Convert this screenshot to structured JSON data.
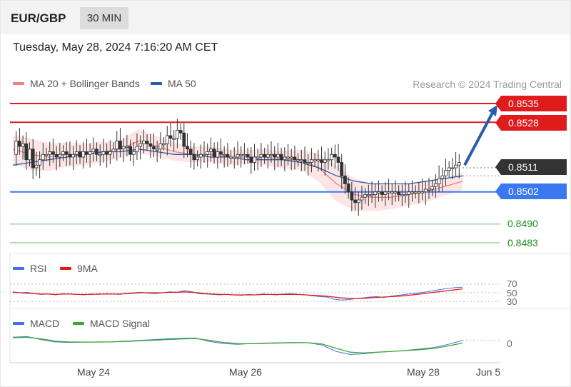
{
  "header": {
    "pair": "EUR/GBP",
    "timeframe": "30 MIN"
  },
  "timestamp": "Tuesday, May 28, 2024 7:16:20 AM CET",
  "credit": "Research © 2024 Trading Central",
  "colors": {
    "resistance": "#e01b1b",
    "support": "#3a78f2",
    "current": "#333333",
    "pivot_green": "#1e8f1e",
    "ma20": "#f08080",
    "ma50": "#2a5fa8",
    "bollinger_fill": "#fde0e0",
    "arrow": "#2a5fa8",
    "rsi": "#4a6fe3",
    "rsi_ma": "#e01b1b",
    "macd": "#4a6fe3",
    "macd_signal": "#3aa832"
  },
  "chart_data": [
    {
      "type": "candlestick",
      "title": "EUR/GBP 30 MIN",
      "legend": [
        "MA 20 + Bollinger Bands",
        "MA 50"
      ],
      "ylim": [
        0.848,
        0.854
      ],
      "levels": [
        {
          "label": "0.8535",
          "value": 0.8535,
          "kind": "resistance"
        },
        {
          "label": "0.8528",
          "value": 0.8528,
          "kind": "resistance"
        },
        {
          "label": "0.8511",
          "value": 0.8511,
          "kind": "current"
        },
        {
          "label": "0.8502",
          "value": 0.8502,
          "kind": "support"
        },
        {
          "label": "0.8490",
          "value": 0.849,
          "kind": "pivot"
        },
        {
          "label": "0.8483",
          "value": 0.8483,
          "kind": "pivot"
        }
      ],
      "price_path": [
        0.8516,
        0.8521,
        0.8519,
        0.852,
        0.8514,
        0.8518,
        0.8511,
        0.8512,
        0.8514,
        0.8516,
        0.8516,
        0.8517,
        0.8516,
        0.8515,
        0.8516,
        0.8517,
        0.8516,
        0.8515,
        0.8516,
        0.8517,
        0.8515,
        0.8517,
        0.8516,
        0.8517,
        0.8518,
        0.8516,
        0.8516,
        0.8517,
        0.8516,
        0.8517,
        0.8518,
        0.8521,
        0.8518,
        0.8519,
        0.8519,
        0.8516,
        0.8517,
        0.8519,
        0.852,
        0.8521,
        0.852,
        0.8519,
        0.8518,
        0.8518,
        0.852,
        0.852,
        0.8523,
        0.8522,
        0.8522,
        0.8525,
        0.8524,
        0.8519,
        0.8518,
        0.8516,
        0.8514,
        0.8515,
        0.8516,
        0.8516,
        0.8517,
        0.8518,
        0.8515,
        0.8517,
        0.8516,
        0.8516,
        0.8515,
        0.8515,
        0.8515,
        0.8516,
        0.8516,
        0.8516,
        0.8515,
        0.8513,
        0.8515,
        0.8515,
        0.8516,
        0.8515,
        0.8516,
        0.8516,
        0.8515,
        0.8516,
        0.8514,
        0.8515,
        0.8515,
        0.8515,
        0.8514,
        0.8514,
        0.8514,
        0.8513,
        0.8513,
        0.8514,
        0.8514,
        0.8514,
        0.8513,
        0.8514,
        0.8514,
        0.8516,
        0.8515,
        0.8513,
        0.8508,
        0.8505,
        0.8502,
        0.8499,
        0.8498,
        0.8499,
        0.85,
        0.8501,
        0.8501,
        0.8501,
        0.8502,
        0.8502,
        0.8501,
        0.8502,
        0.8502,
        0.8502,
        0.8502,
        0.8501,
        0.8501,
        0.8501,
        0.8502,
        0.8502,
        0.8502,
        0.8502,
        0.8502,
        0.8503,
        0.8503,
        0.8504,
        0.8505,
        0.8507,
        0.8508,
        0.851,
        0.8511,
        0.8511,
        0.8512,
        0.8513
      ],
      "ma50_path": [
        0.8512,
        0.8513,
        0.8514,
        0.8515,
        0.8516,
        0.8517,
        0.8517,
        0.8518,
        0.8517,
        0.8516,
        0.8516,
        0.8515,
        0.8515,
        0.8514,
        0.8514,
        0.8514,
        0.8513,
        0.8511,
        0.8508,
        0.8506,
        0.8505,
        0.8505,
        0.8505,
        0.8506,
        0.8507,
        0.8508
      ],
      "ma20_path": [
        0.8518,
        0.8516,
        0.8515,
        0.8516,
        0.8516,
        0.8517,
        0.8518,
        0.8521,
        0.8519,
        0.8517,
        0.8516,
        0.8516,
        0.8515,
        0.8515,
        0.8515,
        0.8514,
        0.8514,
        0.8511,
        0.8505,
        0.8501,
        0.85,
        0.85,
        0.8501,
        0.8502,
        0.8504,
        0.8506
      ],
      "forecast": {
        "from": 0.8512,
        "to": 0.8535
      }
    },
    {
      "type": "line",
      "legend": [
        "RSI",
        "9MA"
      ],
      "ylim": [
        20,
        80
      ],
      "tick_labels": [
        "70",
        "50",
        "30"
      ],
      "ticks": [
        70,
        50,
        30
      ],
      "rsi": [
        52,
        50,
        51,
        48,
        46,
        47,
        45,
        48,
        47,
        46,
        45,
        47,
        46,
        48,
        47,
        46,
        49,
        50,
        51,
        49,
        48,
        50,
        52,
        51,
        55,
        53,
        48,
        47,
        46,
        45,
        46,
        45,
        44,
        46,
        45,
        47,
        46,
        45,
        47,
        48,
        46,
        45,
        43,
        41,
        40,
        35,
        33,
        34,
        36,
        38,
        40,
        41,
        39,
        42,
        44,
        46,
        48,
        50,
        52,
        55,
        58,
        60,
        62,
        63
      ],
      "rsi_ma": [
        51,
        50,
        49,
        48,
        47,
        47,
        46,
        47,
        47,
        46,
        46,
        46,
        47,
        47,
        47,
        47,
        48,
        49,
        50,
        50,
        50,
        50,
        51,
        51,
        52,
        51,
        50,
        48,
        47,
        46,
        46,
        45,
        45,
        45,
        45,
        46,
        46,
        46,
        46,
        46,
        46,
        45,
        44,
        43,
        42,
        40,
        38,
        37,
        36,
        37,
        38,
        39,
        40,
        41,
        42,
        43,
        45,
        47,
        49,
        51,
        53,
        55,
        57,
        59
      ]
    },
    {
      "type": "line",
      "legend": [
        "MACD",
        "MACD Signal"
      ],
      "ylim": [
        -1,
        1
      ],
      "tick_labels": [
        "0"
      ],
      "ticks": [
        0
      ],
      "macd": [
        0.35,
        0.4,
        0.2,
        0.05,
        0.02,
        0.03,
        0.05,
        0.06,
        0.1,
        0.15,
        0.2,
        0.25,
        0.28,
        0.3,
        0.08,
        -0.05,
        -0.1,
        -0.05,
        -0.02,
        0.0,
        0.02,
        0.0,
        -0.15,
        -0.55,
        -0.75,
        -0.7,
        -0.6,
        -0.55,
        -0.48,
        -0.4,
        -0.3,
        -0.1,
        0.15
      ],
      "macd_signal": [
        0.32,
        0.35,
        0.25,
        0.1,
        0.05,
        0.04,
        0.04,
        0.05,
        0.08,
        0.12,
        0.16,
        0.2,
        0.24,
        0.27,
        0.15,
        0.02,
        -0.05,
        -0.06,
        -0.04,
        -0.02,
        0.0,
        0.0,
        -0.08,
        -0.35,
        -0.6,
        -0.65,
        -0.6,
        -0.55,
        -0.5,
        -0.44,
        -0.36,
        -0.2,
        -0.02
      ]
    }
  ],
  "x_axis": {
    "labels": [
      "May 24",
      "May 26",
      "May 28",
      "Jun 5"
    ]
  }
}
